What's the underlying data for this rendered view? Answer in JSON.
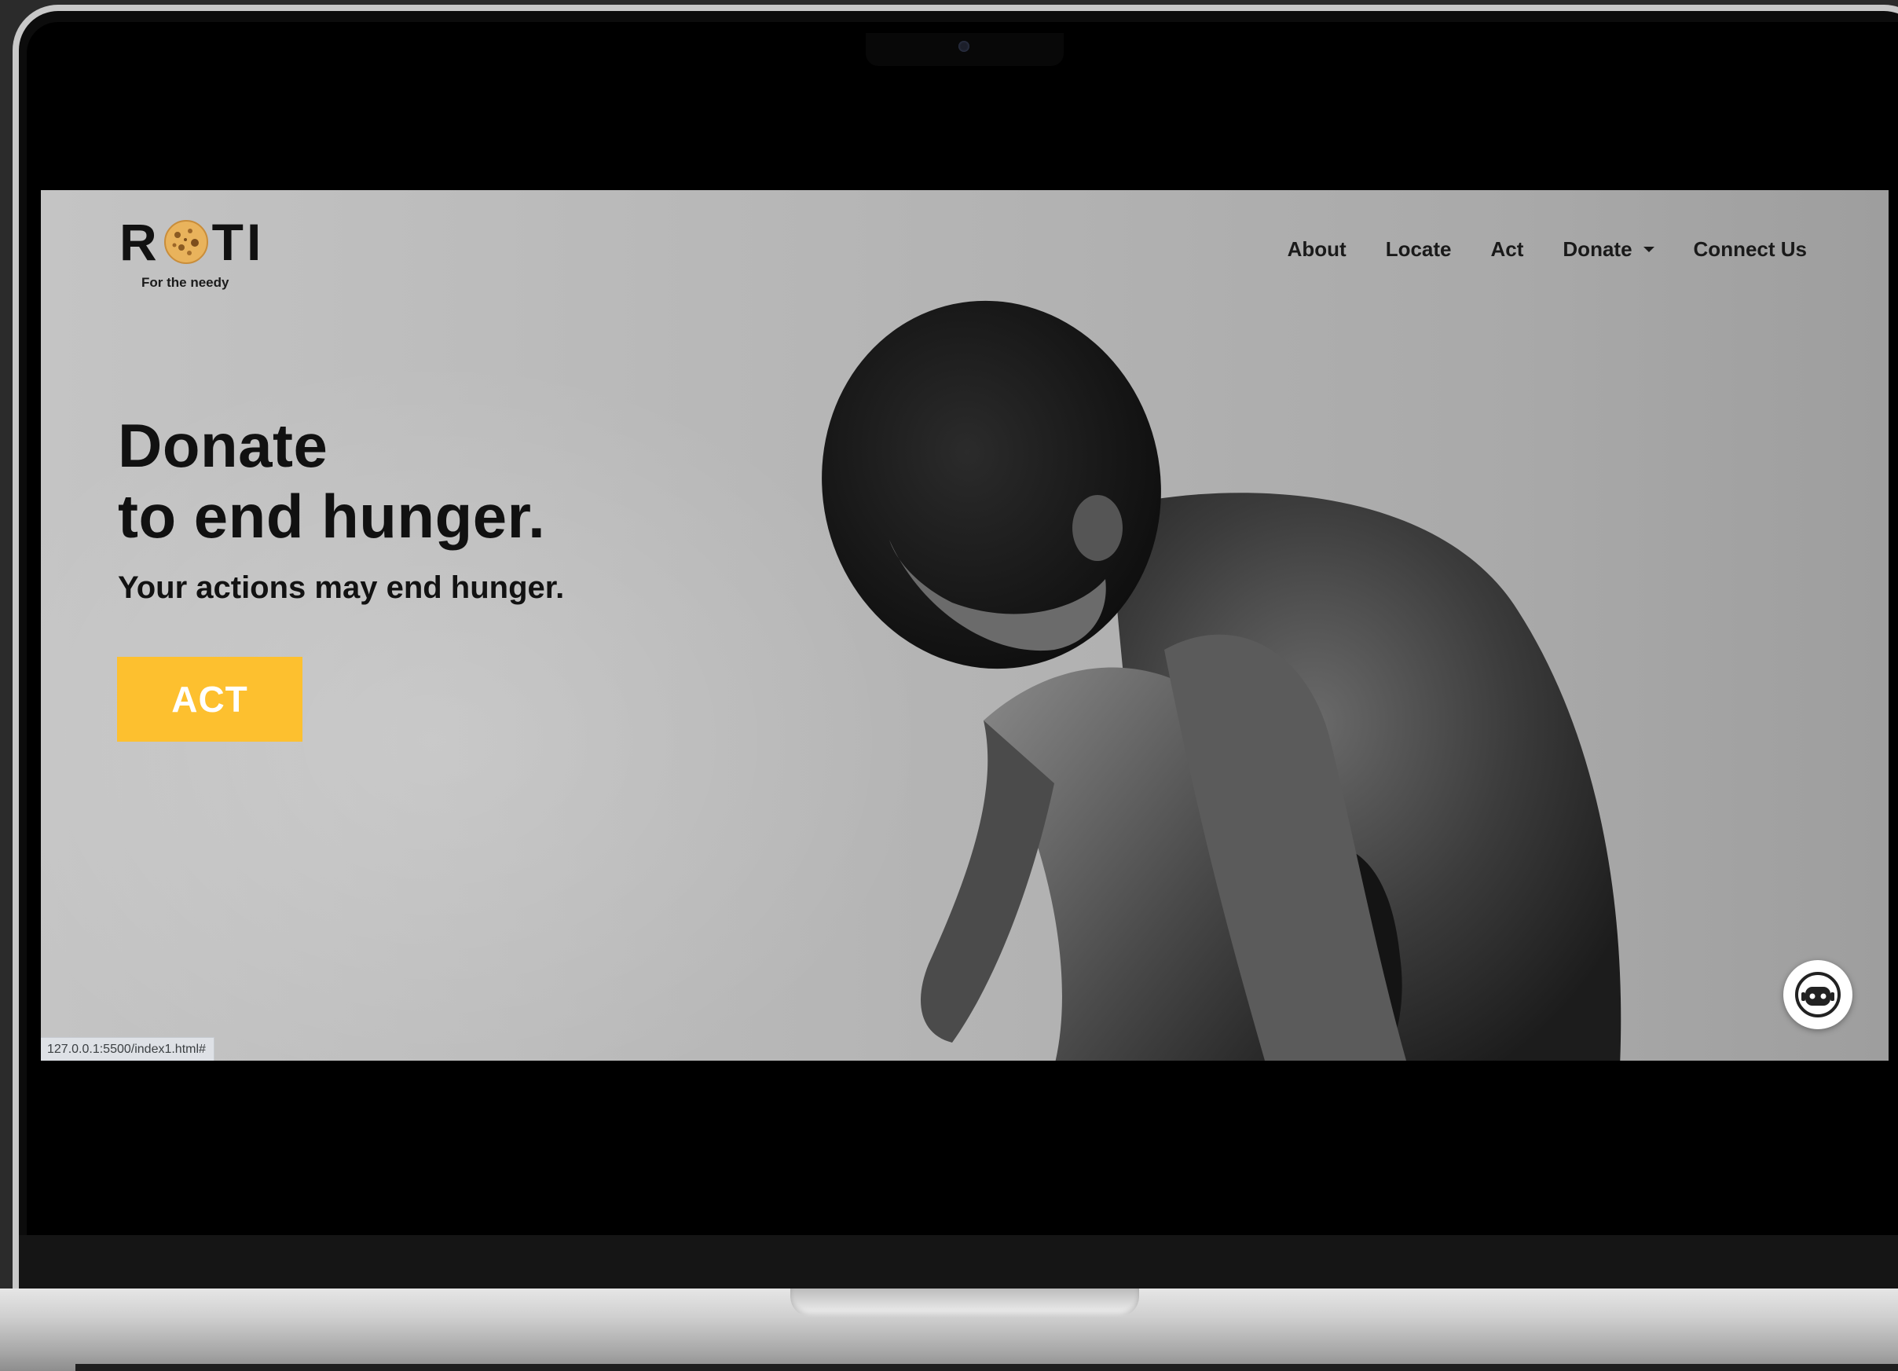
{
  "brand": {
    "name_part1": "R",
    "name_part2": "TI",
    "tagline": "For the needy",
    "logo_icon": "roti-bread-icon"
  },
  "nav": {
    "items": [
      {
        "label": "About"
      },
      {
        "label": "Locate"
      },
      {
        "label": "Act"
      },
      {
        "label": "Donate",
        "has_dropdown": true
      },
      {
        "label": "Connect Us"
      }
    ]
  },
  "hero": {
    "title_line1": "Donate",
    "title_line2": "to end hunger.",
    "subtitle": "Your actions may end hunger.",
    "cta_label": "ACT"
  },
  "chatbot": {
    "icon": "chatbot-robot-icon"
  },
  "status_bar": {
    "url": "127.0.0.1:5500/index1.html#"
  },
  "colors": {
    "accent": "#fdc02f",
    "text": "#111111",
    "hero_background": "#b8b8b8"
  }
}
